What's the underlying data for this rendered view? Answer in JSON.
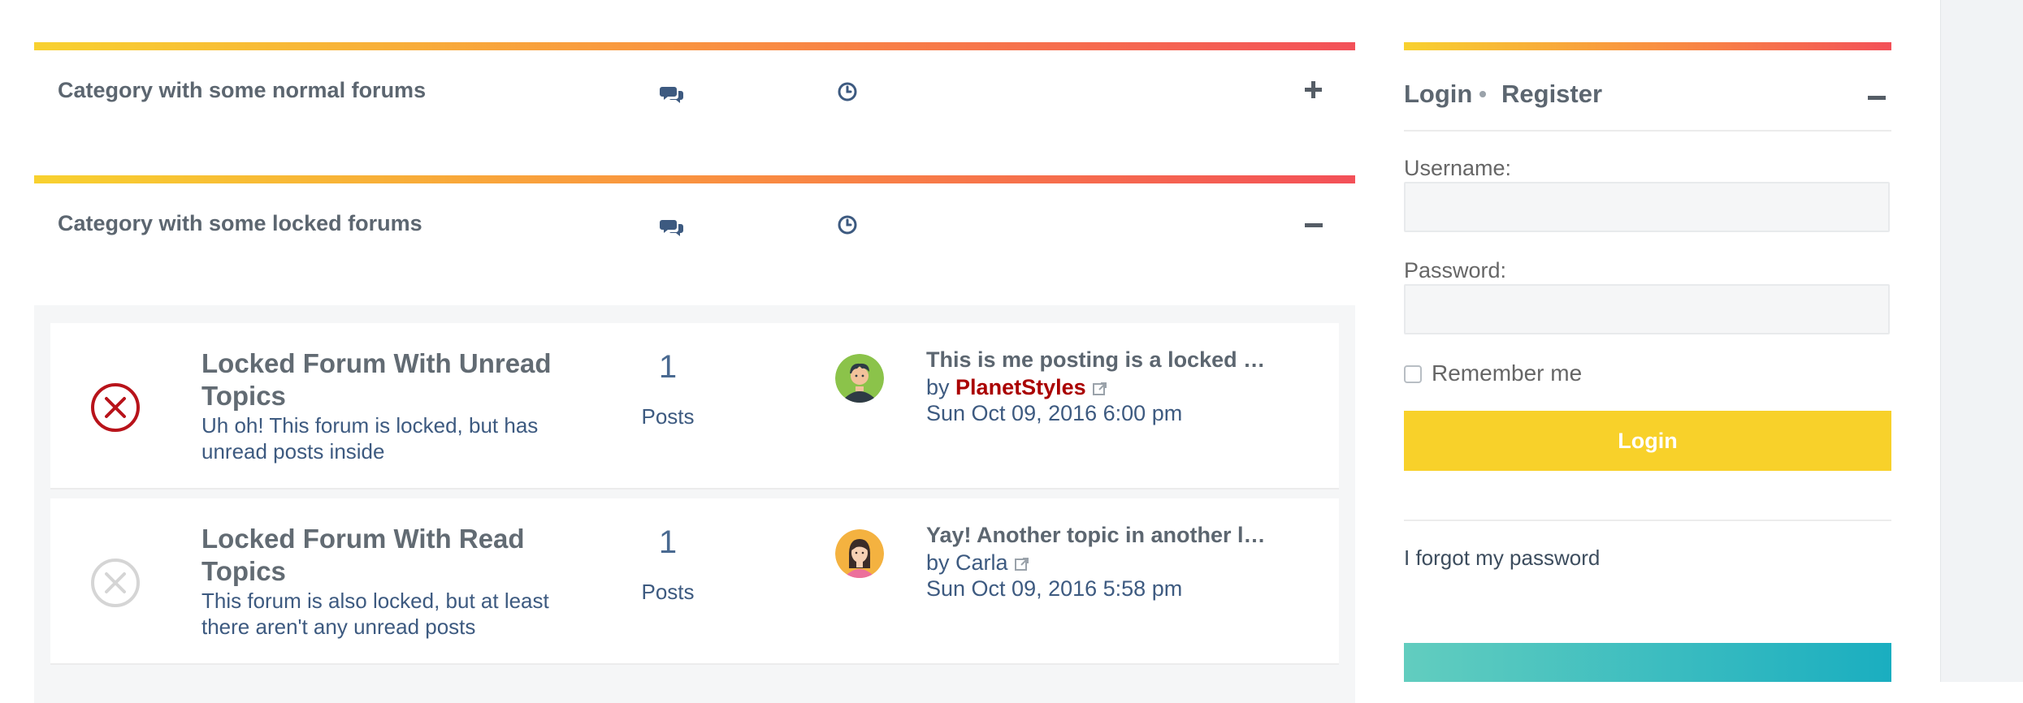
{
  "categories": [
    {
      "title": "Category with some normal forums",
      "toggle": "+",
      "collapsed": true
    },
    {
      "title": "Category with some locked forums",
      "toggle": "−",
      "collapsed": false,
      "forums": [
        {
          "title": "Locked Forum With Unread Topics",
          "description": "Uh oh! This forum is locked, but has unread posts inside",
          "status": "locked-unread",
          "posts_count": "1",
          "posts_label": "Posts",
          "last_post": {
            "title": "This is me posting is a locked forum",
            "by_prefix": "by",
            "author": "PlanetStyles",
            "author_color": "#aa0000",
            "time": "Sun Oct 09, 2016 6:00 pm",
            "avatar": "male-avatar-icon"
          }
        },
        {
          "title": "Locked Forum With Read Topics",
          "description": "This forum is also locked, but at least there aren't any unread posts",
          "status": "locked-read",
          "posts_count": "1",
          "posts_label": "Posts",
          "last_post": {
            "title": "Yay! Another topic in another locked forum",
            "by_prefix": "by",
            "author": "Carla",
            "author_color": "#3d5a80",
            "time": "Sun Oct 09, 2016 5:58 pm",
            "avatar": "female-avatar-icon"
          }
        }
      ]
    }
  ],
  "login": {
    "login_link": "Login",
    "register_link": "Register",
    "username_label": "Username:",
    "username_value": "",
    "password_label": "Password:",
    "password_value": "",
    "remember_label": "Remember me",
    "remember_checked": false,
    "button_label": "Login",
    "forgot_link": "I forgot my password"
  },
  "colors": {
    "accent_yellow": "#f8d12a",
    "accent_red": "#f35058",
    "locked_unread": "#b8131a",
    "locked_read": "#d5d5d5",
    "text_blue": "#3d5a80"
  }
}
